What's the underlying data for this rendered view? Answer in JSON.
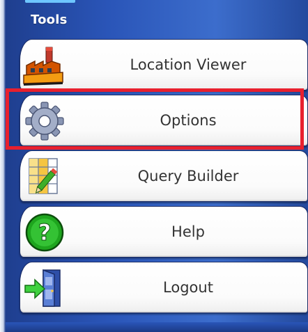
{
  "panel": {
    "title": "Tools"
  },
  "tools": [
    {
      "label": "Location Viewer",
      "icon": "factory-icon"
    },
    {
      "label": "Options",
      "icon": "gear-icon",
      "selected": true
    },
    {
      "label": "Query Builder",
      "icon": "grid-pencil-icon"
    },
    {
      "label": "Help",
      "icon": "help-question-icon"
    },
    {
      "label": "Logout",
      "icon": "logout-door-icon"
    }
  ],
  "colors": {
    "panel_blue": "#2a55b8",
    "selection_red": "#e8202e",
    "help_green": "#1ea51e"
  }
}
